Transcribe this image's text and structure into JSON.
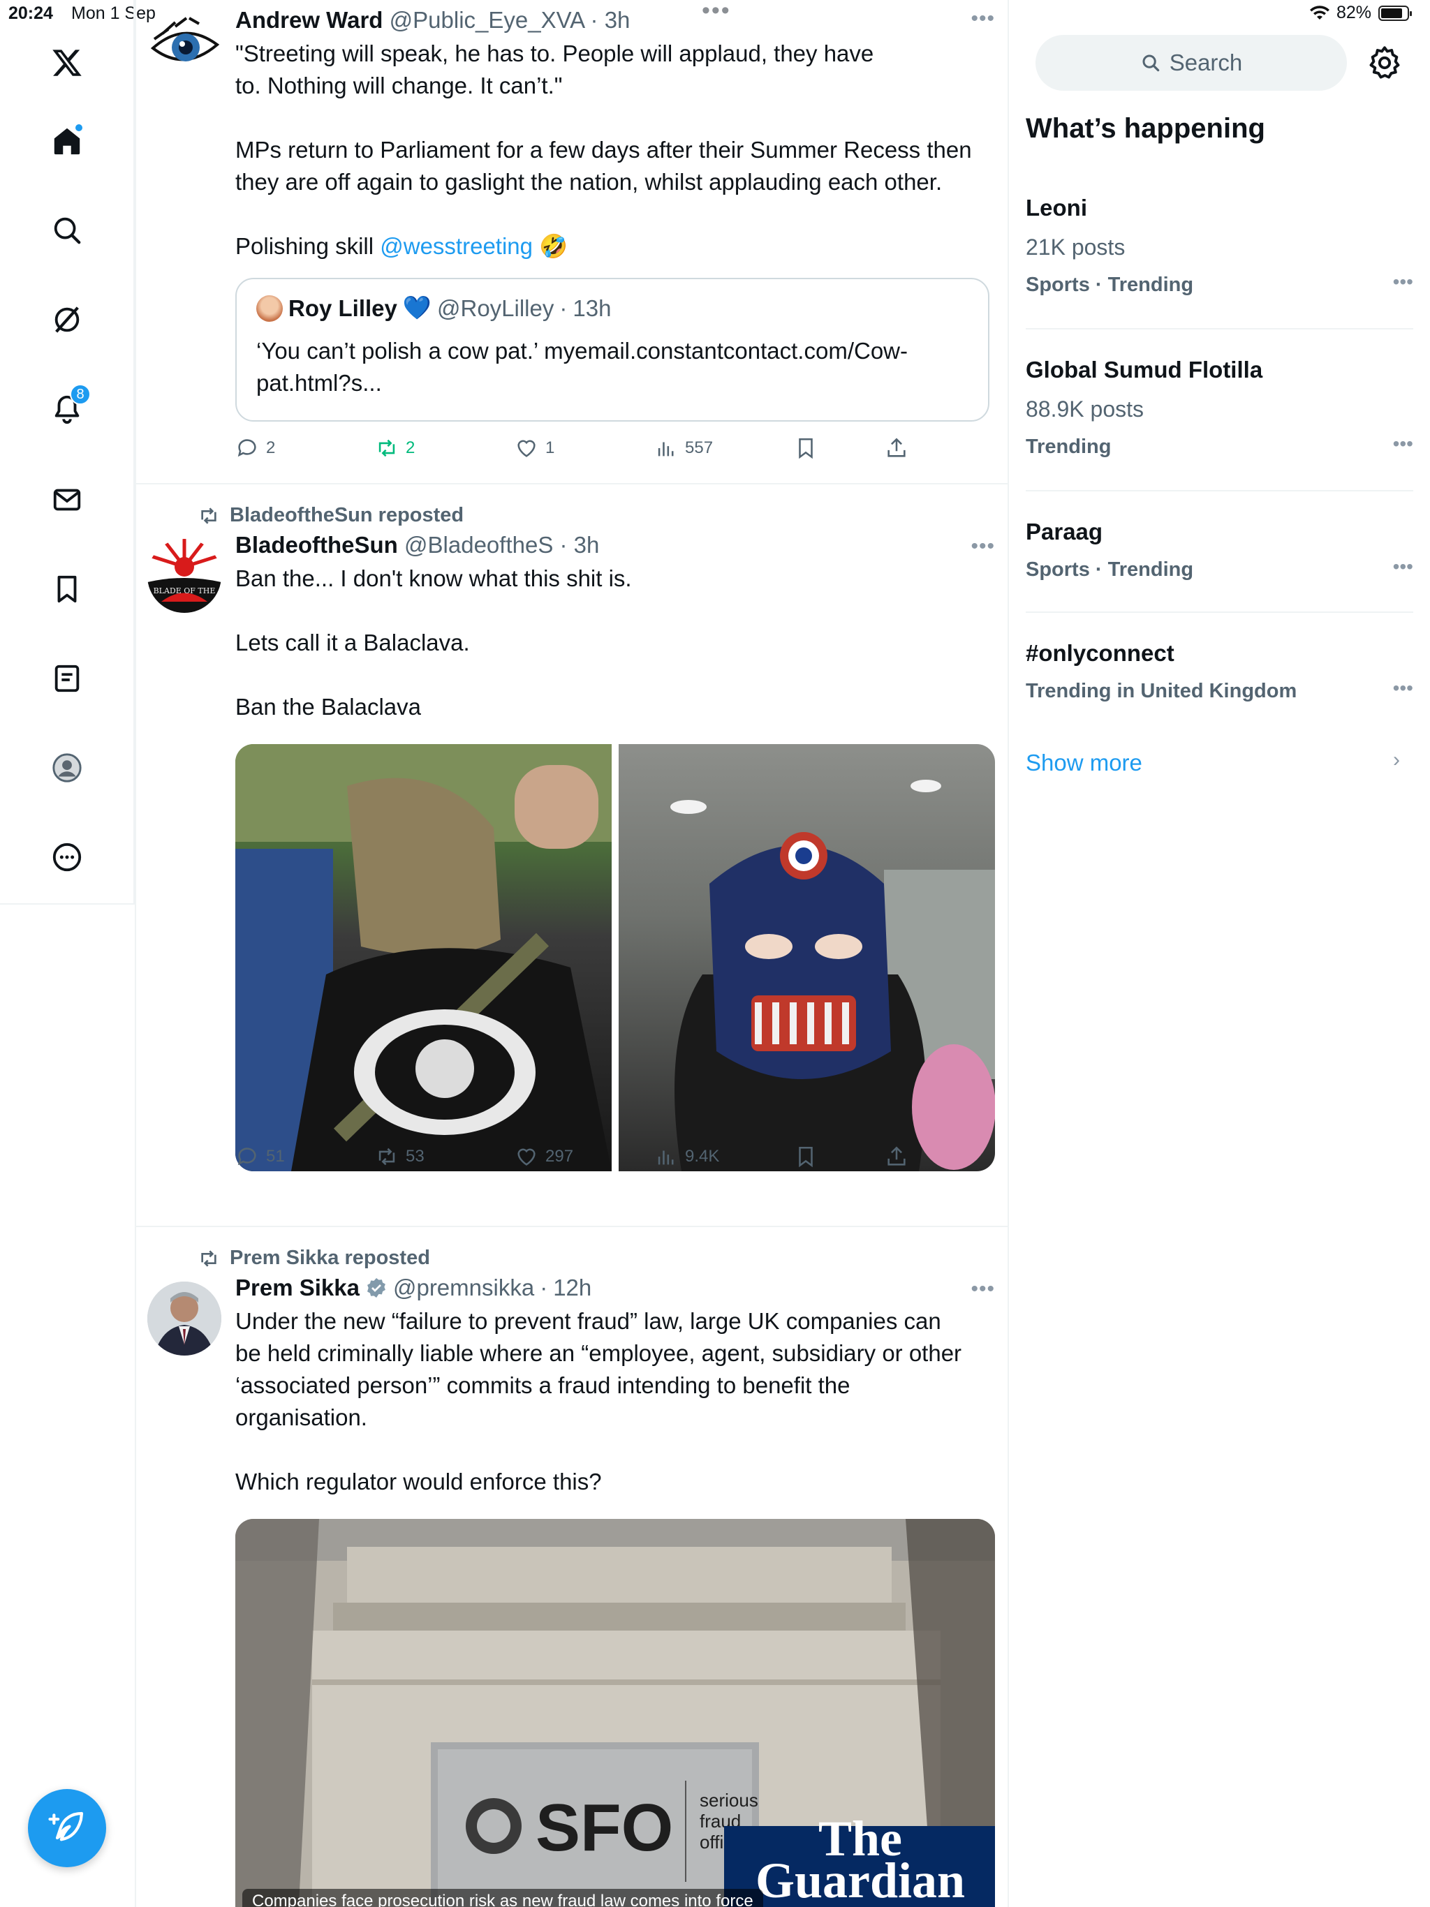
{
  "status_bar": {
    "time": "20:24",
    "date": "Mon 1 Sep",
    "battery": "82%",
    "battery_level": 0.82
  },
  "nav": {
    "notifications_badge": "8",
    "items": [
      "home",
      "explore",
      "grok",
      "notifications",
      "messages",
      "bookmarks",
      "lists",
      "profile",
      "more"
    ]
  },
  "tweets": [
    {
      "name": "Andrew Ward",
      "handle": "@Public_Eye_XVA",
      "time": "3h",
      "text": "\"Streeting will speak, he has to. People will applaud, they have\nto. Nothing will change. It can’t.\"\n\nMPs return to Parliament for a few days after their Summer Recess then\nthey are off again to gaslight the nation, whilst applauding each other.\n\nPolishing skill ",
      "mention": "@wesstreeting",
      "emoji": "🤣",
      "quote": {
        "name": "Roy Lilley",
        "verified_emoji": "💙",
        "handle": "@RoyLilley",
        "time": "13h",
        "text": "‘You can’t polish a cow pat.’ myemail.constantcontact.com/Cow-\npat.html?s..."
      },
      "replies": "2",
      "reposts": "2",
      "likes": "1",
      "views": "557"
    },
    {
      "reposted_by": "BladeoftheSun reposted",
      "name": "BladeoftheSun",
      "handle": "@BladeoftheS",
      "time": "3h",
      "text": "Ban the... I don't know what this shit is.\n\nLets call it a Balaclava.\n\nBan the Balaclava",
      "avatar_text": "BLADE OF THE",
      "replies": "51",
      "reposts": "53",
      "likes": "297",
      "views": "9.4K"
    },
    {
      "reposted_by": "Prem Sikka reposted",
      "name": "Prem Sikka",
      "handle": "@premnsikka",
      "time": "12h",
      "text": "Under the new “failure to prevent fraud” law, large UK companies can\nbe held criminally liable where an “employee, agent, subsidiary or other\n‘associated person’” commits a fraud intending to benefit the\norganisation.\n\nWhich regulator would enforce this?",
      "card": {
        "sign_logo": "SFO",
        "sign_text": "serious\nfraud\noffice",
        "brand": "The\nGuardian",
        "caption": "Companies face prosecution risk as new fraud law comes into force"
      }
    }
  ],
  "right": {
    "search_placeholder": "Search",
    "title": "What’s happening",
    "trends": [
      {
        "name": "Leoni",
        "count": "21K posts",
        "category": "Sports · Trending"
      },
      {
        "name": "Global Sumud Flotilla",
        "count": "88.9K posts",
        "category": "Trending"
      },
      {
        "name": "Paraag",
        "count": "",
        "category": "Sports · Trending"
      },
      {
        "name": "#onlyconnect",
        "count": "",
        "category": "Trending in United Kingdom"
      }
    ],
    "show_more": "Show more"
  },
  "colors": {
    "accent": "#1d9bf0",
    "repost_green": "#00ba7c",
    "muted": "#536471"
  }
}
